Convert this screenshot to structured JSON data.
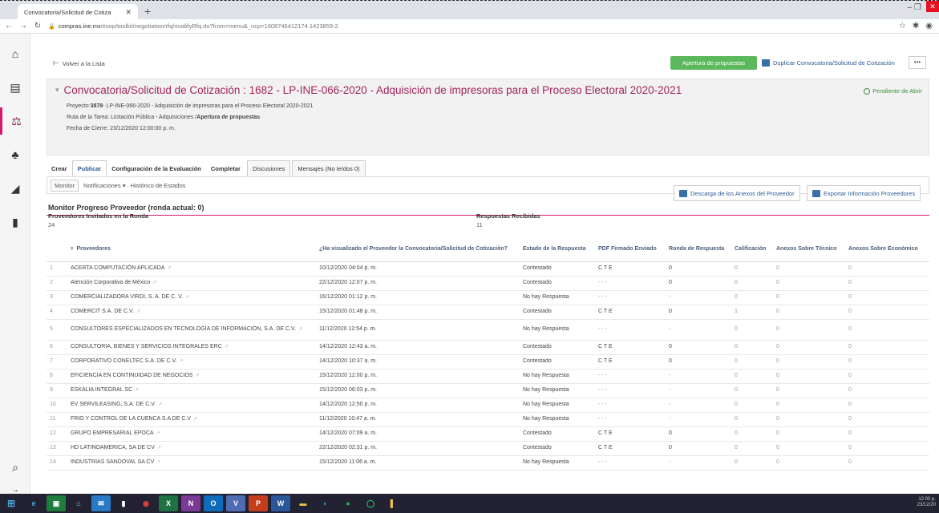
{
  "browser": {
    "tab_title": "Convocatoria/Solicitud de Cotiza",
    "url_host": "compras.ine.mx",
    "url_path": "/esop/toolkit/negotiation/rfq/modifyRfq.do?from=menu&_ncp=1608746412174.1423859-2"
  },
  "actions": {
    "back": "Volver a la Lista",
    "open_proposals": "Apertura de propuestas",
    "duplicate": "Duplicar Convocatoria/Solicitud de Cotización",
    "more": "•••"
  },
  "header": {
    "title": "Convocatoria/Solicitud de Cotización : 1682 - LP-INE-066-2020 - Adquisición de impresoras para el Proceso Electoral 2020-2021",
    "status": "Pendiente de Abrir",
    "project_label": "Proyecto:",
    "project_code": "3878",
    "project_desc": "- LP-INE-066-2020 - Adquisición de impresoras para el Proceso Electoral 2020-2021",
    "route_label": "Ruta de la Tarea: Licitación Pública - Adquisiciones /",
    "route_current": "Apertura de propuestas",
    "close_date": "Fecha de Cierre: 23/12/2020 12:00:00 p. m."
  },
  "tabs": [
    "Crear",
    "Publicar",
    "Configuración de la Evaluación",
    "Completar",
    "Discusiones",
    "Mensajes (No leídos 0)"
  ],
  "subnav": {
    "monitor": "Monitor",
    "notifications": "Notificaciones",
    "history": "Histórico de Estados"
  },
  "monitor": {
    "title": "Monitor Progreso Proveedor (ronda actual: 0)",
    "download_btn": "Descarga de los Anexos del Proveedor",
    "export_btn": "Exportar Información Proveedores",
    "invited_label": "Proveedores Invitados en la Ronda",
    "invited_value": "24",
    "responses_label": "Respuestas Recibidas",
    "responses_value": "11"
  },
  "table": {
    "headers": [
      "Proveedores",
      "¿Ha visualizado el Proveedor la Convocatoria/Solicitud de Cotización?",
      "Estado de la Respuesta",
      "PDF Firmado Enviado",
      "Ronda de Respuesta",
      "Calificación",
      "Anexos Sobre Técnico",
      "Anexos Sobre Económico"
    ],
    "rows": [
      [
        "1",
        "ACERTA COMPUTACIÓN APLICADA",
        "10/12/2020 04:04 p. m.",
        "Contestado",
        "C T E",
        "0",
        "0",
        "0",
        "0"
      ],
      [
        "2",
        "Atención Corporativa de México",
        "22/12/2020 12:07 p. m.",
        "Contestado",
        "- - -",
        "0",
        "0",
        "0",
        "0"
      ],
      [
        "3",
        "COMERCIALIZADORA VIRDI, S. A. DE C. V.",
        "16/12/2020 01:12 p. m.",
        "No hay Respuesta",
        "- - -",
        "-",
        "0",
        "0",
        "0"
      ],
      [
        "4",
        "COMERCIT S.A. DE C.V.",
        "15/12/2020 01:48 p. m.",
        "Contestado",
        "C T E",
        "0",
        "1",
        "0",
        "0"
      ],
      [
        "5",
        "CONSULTORES ESPECIALIZADOS EN TECNOLOGÍA DE INFORMACIÓN, S.A. DE C.V.",
        "11/12/2020 12:54 p. m.",
        "No hay Respuesta",
        "- - -",
        "-",
        "0",
        "0",
        "0"
      ],
      [
        "6",
        "CONSULTORIA, BIENES Y SERVICIOS INTEGRALES ERC",
        "14/12/2020 12:43 a. m.",
        "Contestado",
        "C T E",
        "0",
        "0",
        "0",
        "0"
      ],
      [
        "7",
        "CORPORATIVO CONELTEC S.A. DE C.V.",
        "14/12/2020 10:37 a. m.",
        "Contestado",
        "C T E",
        "0",
        "0",
        "0",
        "0"
      ],
      [
        "8",
        "EFICIENCIA EN CONTINUIDAD DE NEGOCIOS",
        "15/12/2020 12:00 p. m.",
        "No hay Respuesta",
        "- - -",
        "-",
        "0",
        "0",
        "0"
      ],
      [
        "9",
        "ESKALIA INTEGRAL SC",
        "15/12/2020 06:03 p. m.",
        "No hay Respuesta",
        "- - -",
        "-",
        "0",
        "0",
        "0"
      ],
      [
        "10",
        "EV SERVILEASING, S.A. DE C.V.",
        "14/12/2020 12:50 p. m.",
        "No hay Respuesta",
        "- - -",
        "-",
        "0",
        "0",
        "0"
      ],
      [
        "11",
        "FRIO Y CONTROL DE LA CUENCA S.A DE C.V",
        "11/12/2020 10:47 a. m.",
        "No hay Respuesta",
        "- - -",
        "-",
        "0",
        "0",
        "0"
      ],
      [
        "12",
        "GRUPO EMPRESARIAL EPOCA",
        "14/12/2020 07:09 a. m.",
        "Contestado",
        "C T E",
        "0",
        "0",
        "0",
        "0"
      ],
      [
        "13",
        "HD LATINOAMERICA, SA DE CV",
        "22/12/2020 02:31 p. m.",
        "Contestado",
        "C T E",
        "0",
        "0",
        "0",
        "0"
      ],
      [
        "14",
        "INDUSTRIAS SANDOVAL SA CV",
        "15/12/2020 11:06 a. m.",
        "No hay Respuesta",
        "- - -",
        "-",
        "0",
        "0",
        "0"
      ]
    ]
  },
  "taskbar": {
    "time": "12:00 p.",
    "date": "23/12/20"
  }
}
